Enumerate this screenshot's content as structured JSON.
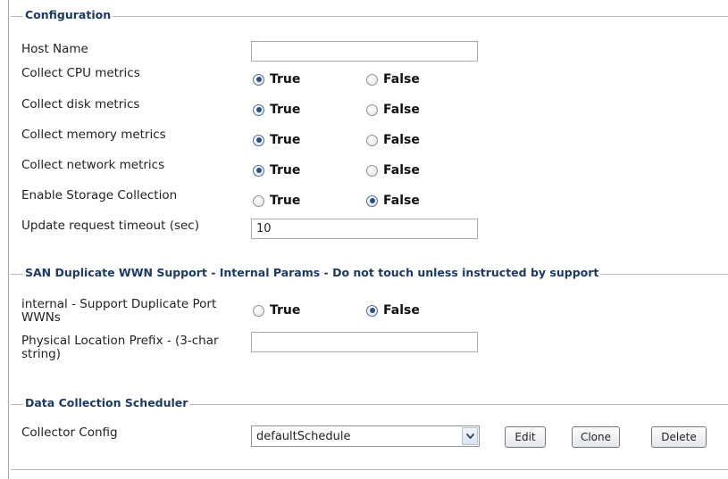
{
  "configuration": {
    "legend": "Configuration",
    "host_name": {
      "label": "Host Name",
      "value": ""
    },
    "cpu": {
      "label": "Collect CPU metrics",
      "true_label": "True",
      "false_label": "False",
      "selected": "True"
    },
    "disk": {
      "label": "Collect disk metrics",
      "true_label": "True",
      "false_label": "False",
      "selected": "True"
    },
    "memory": {
      "label": "Collect memory metrics",
      "true_label": "True",
      "false_label": "False",
      "selected": "True"
    },
    "network": {
      "label": "Collect network metrics",
      "true_label": "True",
      "false_label": "False",
      "selected": "True"
    },
    "storage": {
      "label": "Enable Storage Collection",
      "true_label": "True",
      "false_label": "False",
      "selected": "False"
    },
    "timeout": {
      "label": "Update request timeout (sec)",
      "value": "10"
    }
  },
  "san": {
    "legend": "SAN Duplicate WWN Support - Internal Params - Do not touch unless instructed by support",
    "duplicate_port": {
      "label": "internal - Support Duplicate Port WWNs",
      "true_label": "True",
      "false_label": "False",
      "selected": "False"
    },
    "location_prefix": {
      "label": "Physical Location Prefix - (3-char string)",
      "value": ""
    }
  },
  "scheduler": {
    "legend": "Data Collection Scheduler",
    "collector": {
      "label": "Collector Config",
      "selected": "defaultSchedule"
    },
    "edit_label": "Edit",
    "clone_label": "Clone",
    "delete_label": "Delete"
  }
}
